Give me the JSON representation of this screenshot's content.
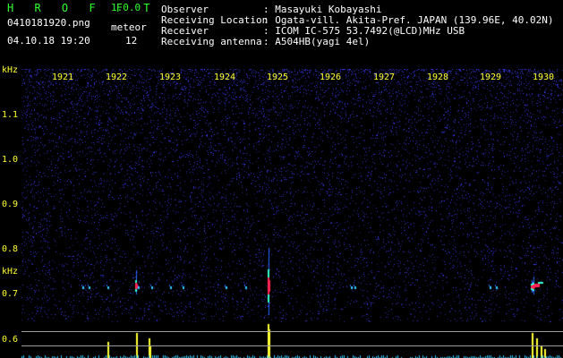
{
  "header": {
    "app_title": "H R O F F T",
    "app_version": "1.0.0",
    "file_name": "0410181920.png",
    "meteor_label": "meteor",
    "datetime": "04.10.18 19:20",
    "meteor_count": "12",
    "info": [
      {
        "label": "Observer",
        "value": ": Masayuki Kobayashi"
      },
      {
        "label": "Receiving Location",
        "value": ": Ogata-vill. Akita-Pref. JAPAN (139.96E, 40.02N)"
      },
      {
        "label": "Receiver",
        "value": ": ICOM IC-575 53.7492(@LCD)MHz USB"
      },
      {
        "label": "Receiving antenna",
        "value": ": A504HB(yagi 4el)"
      }
    ]
  },
  "axis": {
    "y_unit_top": "kHz",
    "y_unit_mid": "kHz",
    "x_ticks": [
      "1921",
      "1922",
      "1923",
      "1924",
      "1925",
      "1926",
      "1927",
      "1928",
      "1929",
      "1930"
    ],
    "y_ticks": [
      "1.1",
      "1.0",
      "0.9",
      "0.8",
      "0.7",
      "0.6"
    ]
  },
  "colors": {
    "title_green": "#33ff33",
    "label_yellow": "#ffff33",
    "noise_blue": "#2a2ad0",
    "signal_cyan": "#33ddff",
    "signal_red": "#ff2255"
  }
}
